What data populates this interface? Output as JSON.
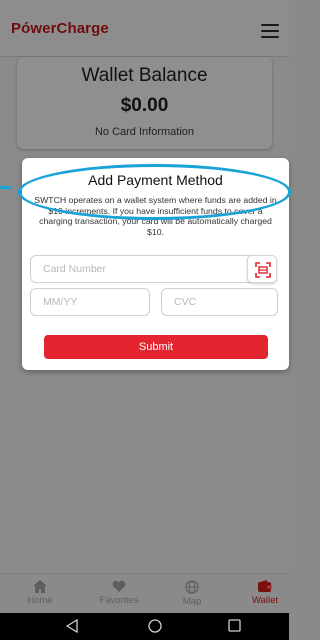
{
  "header": {
    "logo_prefix": "P",
    "logo_bolt": "ó",
    "logo_suffix": "werCharge",
    "menu_icon": "hamburger-icon"
  },
  "balance": {
    "title": "Wallet Balance",
    "amount": "$0.00",
    "card_status": "No Card Information"
  },
  "payment_modal": {
    "title": "Add Payment Method",
    "description": "SWTCH operates on a wallet system where funds are added in $10 increments. If you have insufficient funds to cover a charging transaction, your card will be automatically charged $10.",
    "card_number_placeholder": "Card Number",
    "expiry_placeholder": "MM/YY",
    "cvc_placeholder": "CVC",
    "scan_icon": "card-scan-icon",
    "submit_label": "Submit"
  },
  "bottom_nav": {
    "items": [
      {
        "label": "Home",
        "icon": "home-icon"
      },
      {
        "label": "Favorites",
        "icon": "heart-icon"
      },
      {
        "label": "Map",
        "icon": "globe-icon"
      },
      {
        "label": "Wallet",
        "icon": "wallet-icon",
        "active": true
      }
    ]
  },
  "system_nav": {
    "back_icon": "back-triangle-icon",
    "home_icon": "home-circle-icon",
    "recents_icon": "recents-square-icon"
  },
  "colors": {
    "accent": "#e2252f",
    "highlight": "#1aa3d6",
    "logo": "#6e0c0c",
    "active_nav": "#7a1010"
  }
}
